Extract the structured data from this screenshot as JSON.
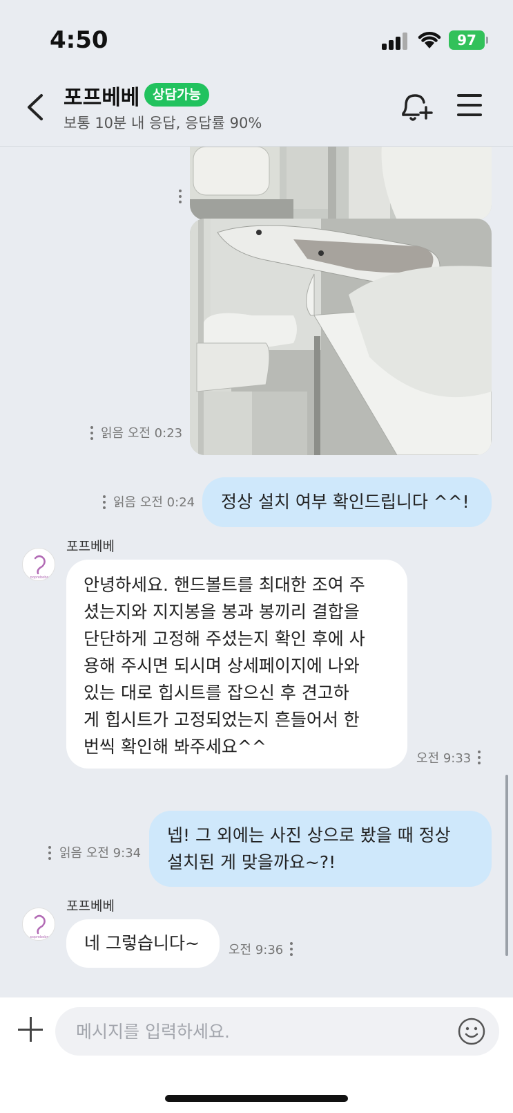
{
  "status_bar": {
    "time": "4:50",
    "battery": "97"
  },
  "header": {
    "name": "포프베베",
    "badge": "상담가능",
    "subtitle": "보통 10분 내 응답, 응답률 90%"
  },
  "messages": [
    {
      "type": "photo",
      "meta": ""
    },
    {
      "type": "photo",
      "meta": "읽음  오전 0:23"
    },
    {
      "type": "mine",
      "text": "정상 설치 여부 확인드립니다 ^^!",
      "meta": "읽음  오전 0:24"
    },
    {
      "type": "theirs",
      "sender": "포프베베",
      "lines": [
        "안녕하세요. 핸드볼트를 최대한 조여 주",
        "셨는지와 지지봉을 봉과 봉끼리 결합을",
        "단단하게 고정해 주셨는지 확인 후에 사",
        "용해 주시면 되시며 상세페이지에 나와",
        "있는 대로 힙시트를 잡으신 후 견고하",
        "게 힙시트가 고정되었는지 흔들어서 한",
        "번씩 확인해 봐주세요^^"
      ],
      "meta": "오전 9:33"
    },
    {
      "type": "mine",
      "lines": [
        "넵! 그 외에는 사진 상으로 봤을 때 정상",
        "설치된 게 맞을까요~?!"
      ],
      "meta": "읽음  오전 9:34"
    },
    {
      "type": "theirs",
      "sender": "포프베베",
      "text": "네 그렇습니다~",
      "meta": "오전 9:36"
    }
  ],
  "avatar_text": "poprebebe",
  "input": {
    "placeholder": "메시지를 입력하세요."
  },
  "colors": {
    "accent": "#21c25e",
    "my_bubble": "#cfe8fb",
    "their_bubble": "#ffffff",
    "background": "#e9ecf1"
  },
  "icons": [
    "back-icon",
    "bell-plus-icon",
    "menu-icon",
    "more-vertical-icon",
    "plus-icon",
    "emoji-icon"
  ]
}
